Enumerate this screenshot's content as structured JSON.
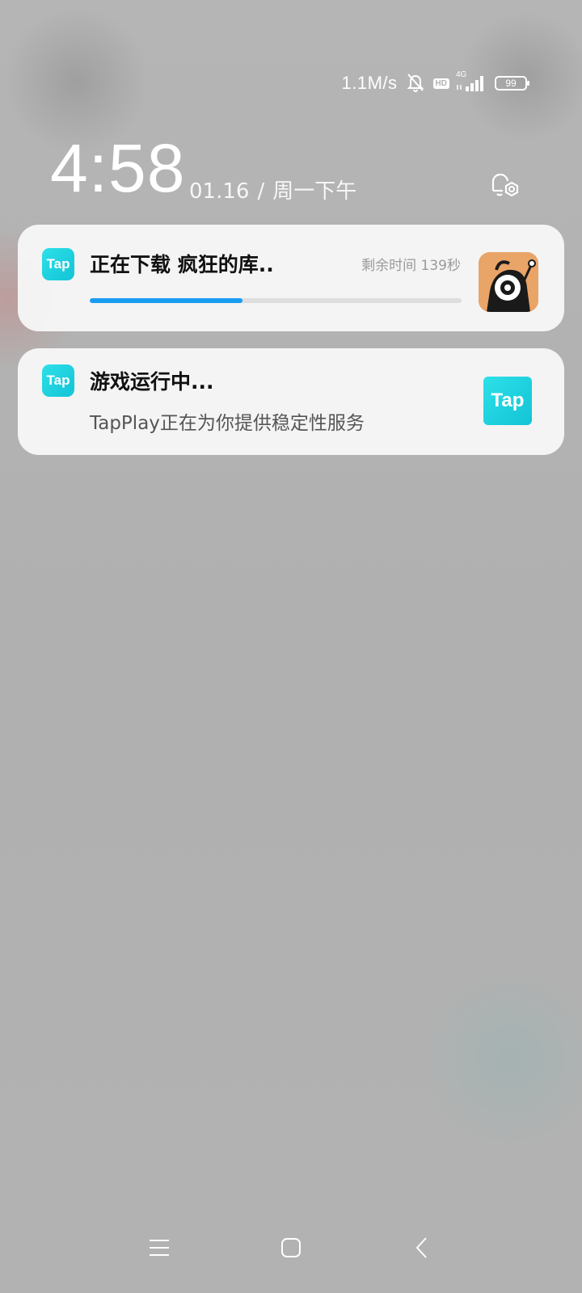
{
  "status_bar": {
    "net_speed": "1.1M/s",
    "network_type": "4G",
    "hd_label": "HD",
    "battery_level": "99"
  },
  "lockscreen": {
    "time": "4:58",
    "date": "01.16",
    "separator": "/",
    "weekday_period": "周一下午"
  },
  "notifications": [
    {
      "app_icon_text": "Tap",
      "title": "正在下载 疯狂的库..",
      "remaining_time": "剩余时间 139秒",
      "progress": 0.41
    },
    {
      "app_icon_text": "Tap",
      "title": "游戏运行中...",
      "text": "TapPlay正在为你提供稳定性服务",
      "large_icon_text": "Tap"
    }
  ],
  "colors": {
    "accent_progress": "#1a9cf0",
    "tap_brand": "#12c4d6"
  }
}
